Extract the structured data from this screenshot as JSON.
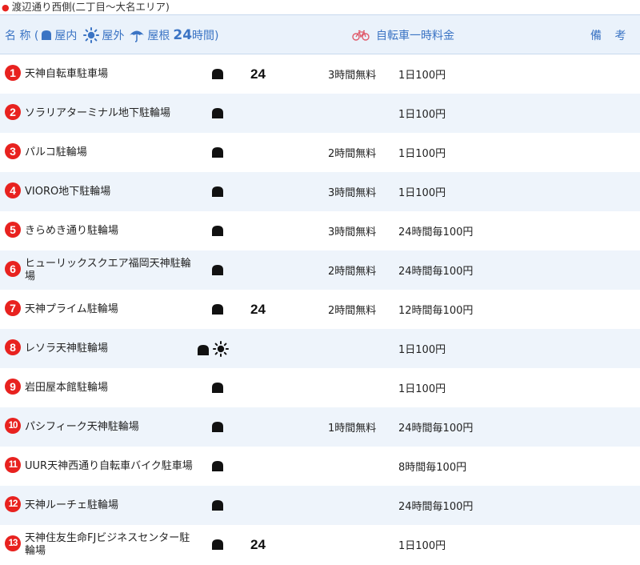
{
  "area_title": "渡辺通り西側(二丁目～大名エリア)",
  "header": {
    "name_label": "名 称 (",
    "indoor_label": "屋内",
    "outdoor_label": "屋外",
    "roof_label": "屋根",
    "hours24_number": "24",
    "hours24_label": "時間)",
    "fee_label": "自転車一時料金",
    "notes_label": "備 考"
  },
  "colors": {
    "header_text": "#3b74c4",
    "header_bg": "#eaf2fb",
    "row_alt_bg": "#eef4fb",
    "number_badge": "#e8221f",
    "bicycle_icon": "#e05a6a"
  },
  "rows": [
    {
      "num": "1",
      "name": "天神自転車駐車場",
      "facility": [
        "indoor"
      ],
      "h24": "24",
      "free": "3時間無料",
      "fee": "1日100円",
      "note": ""
    },
    {
      "num": "2",
      "name": "ソラリアターミナル地下駐輪場",
      "facility": [
        "indoor"
      ],
      "h24": "",
      "free": "",
      "fee": "1日100円",
      "note": ""
    },
    {
      "num": "3",
      "name": "パルコ駐輪場",
      "facility": [
        "indoor"
      ],
      "h24": "",
      "free": "2時間無料",
      "fee": "1日100円",
      "note": ""
    },
    {
      "num": "4",
      "name": "VIORO地下駐輪場",
      "facility": [
        "indoor"
      ],
      "h24": "",
      "free": "3時間無料",
      "fee": "1日100円",
      "note": ""
    },
    {
      "num": "5",
      "name": "きらめき通り駐輪場",
      "facility": [
        "indoor"
      ],
      "h24": "",
      "free": "3時間無料",
      "fee": "24時間毎100円",
      "note": ""
    },
    {
      "num": "6",
      "name": "ヒューリックスクエア福岡天神駐輪場",
      "facility": [
        "indoor"
      ],
      "h24": "",
      "free": "2時間無料",
      "fee": "24時間毎100円",
      "note": ""
    },
    {
      "num": "7",
      "name": "天神プライム駐輪場",
      "facility": [
        "indoor"
      ],
      "h24": "24",
      "free": "2時間無料",
      "fee": "12時間毎100円",
      "note": ""
    },
    {
      "num": "8",
      "name": "レソラ天神駐輪場",
      "facility": [
        "indoor",
        "outdoor"
      ],
      "h24": "",
      "free": "",
      "fee": "1日100円",
      "note": ""
    },
    {
      "num": "9",
      "name": "岩田屋本館駐輪場",
      "facility": [
        "indoor"
      ],
      "h24": "",
      "free": "",
      "fee": "1日100円",
      "note": ""
    },
    {
      "num": "10",
      "name": "パシフィーク天神駐輪場",
      "facility": [
        "indoor"
      ],
      "h24": "",
      "free": "1時間無料",
      "fee": "24時間毎100円",
      "note": ""
    },
    {
      "num": "11",
      "name": "UUR天神西通り自転車バイク駐車場",
      "facility": [
        "indoor"
      ],
      "h24": "",
      "free": "",
      "fee": "8時間毎100円",
      "note": ""
    },
    {
      "num": "12",
      "name": "天神ルーチェ駐輪場",
      "facility": [
        "indoor"
      ],
      "h24": "",
      "free": "",
      "fee": "24時間毎100円",
      "note": ""
    },
    {
      "num": "13",
      "name": "天神住友生命FJビジネスセンター駐輪場",
      "facility": [
        "indoor"
      ],
      "h24": "24",
      "free": "",
      "fee": "1日100円",
      "note": ""
    }
  ]
}
